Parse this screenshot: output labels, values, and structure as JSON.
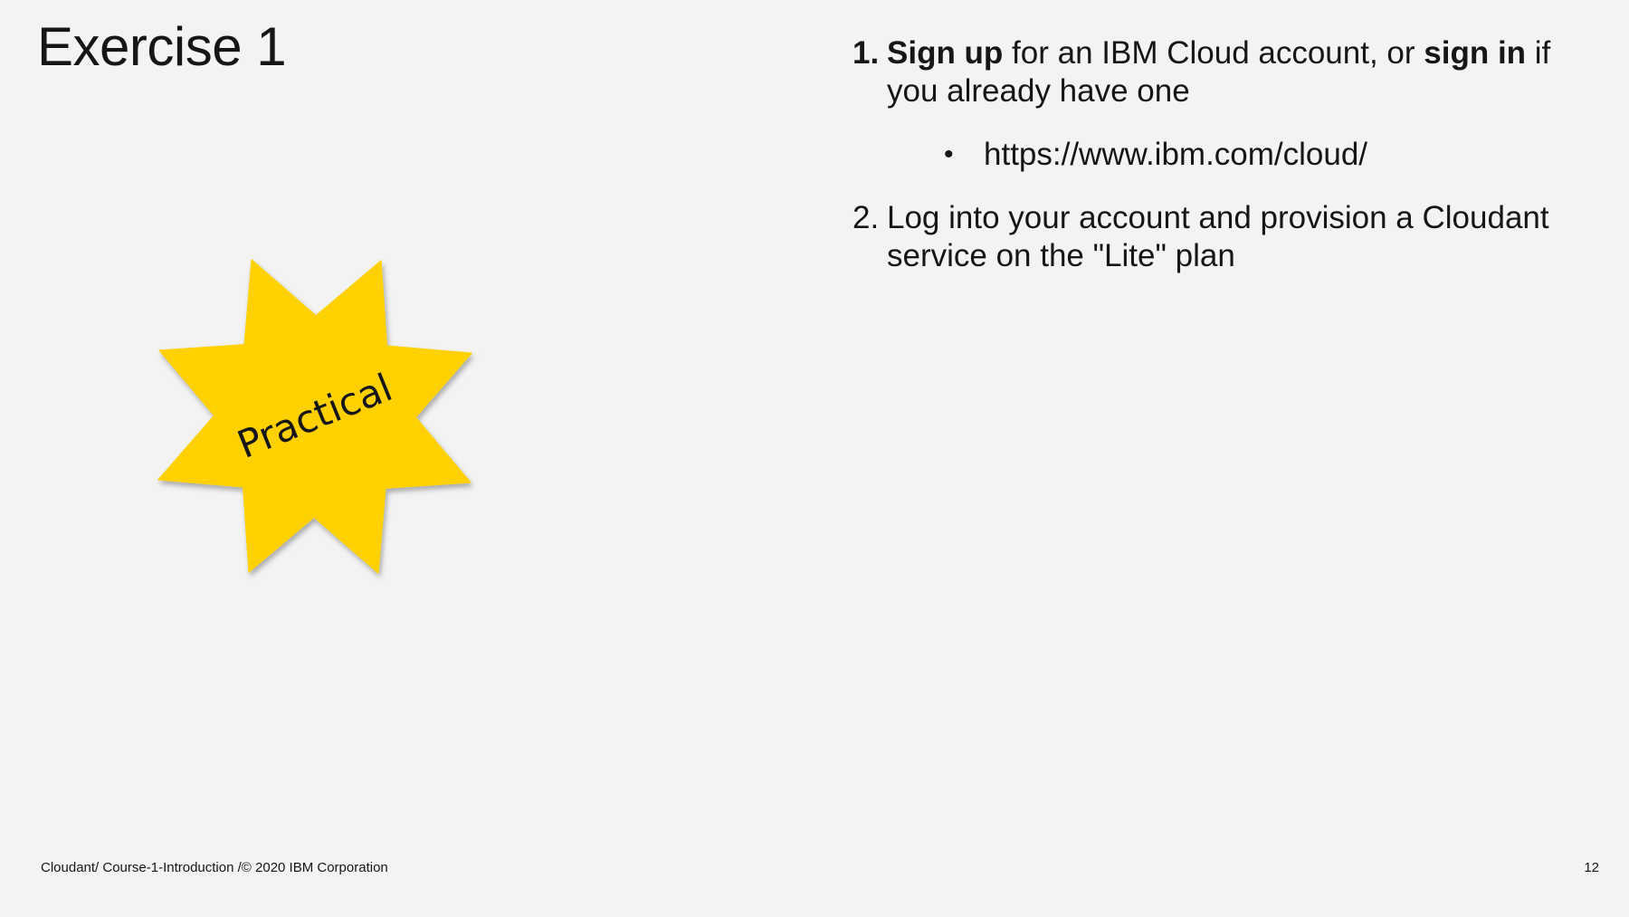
{
  "slide": {
    "title": "Exercise 1",
    "badge_text": "Practical",
    "badge_color": "#ffd100"
  },
  "steps": [
    {
      "number": "1.",
      "parts": {
        "a": "Sign up",
        "b": " for an IBM Cloud account, or ",
        "c": "sign in",
        "d": " if you already have one"
      },
      "sub_items": [
        {
          "bullet": "•",
          "text": "https://www.ibm.com/cloud/"
        }
      ]
    },
    {
      "number": "2.",
      "text": "Log into your account and provision a Cloudant service on the \"Lite\" plan"
    }
  ],
  "footer": {
    "text": "Cloudant/ Course-1-Introduction /© 2020 IBM Corporation",
    "page_number": "12"
  }
}
